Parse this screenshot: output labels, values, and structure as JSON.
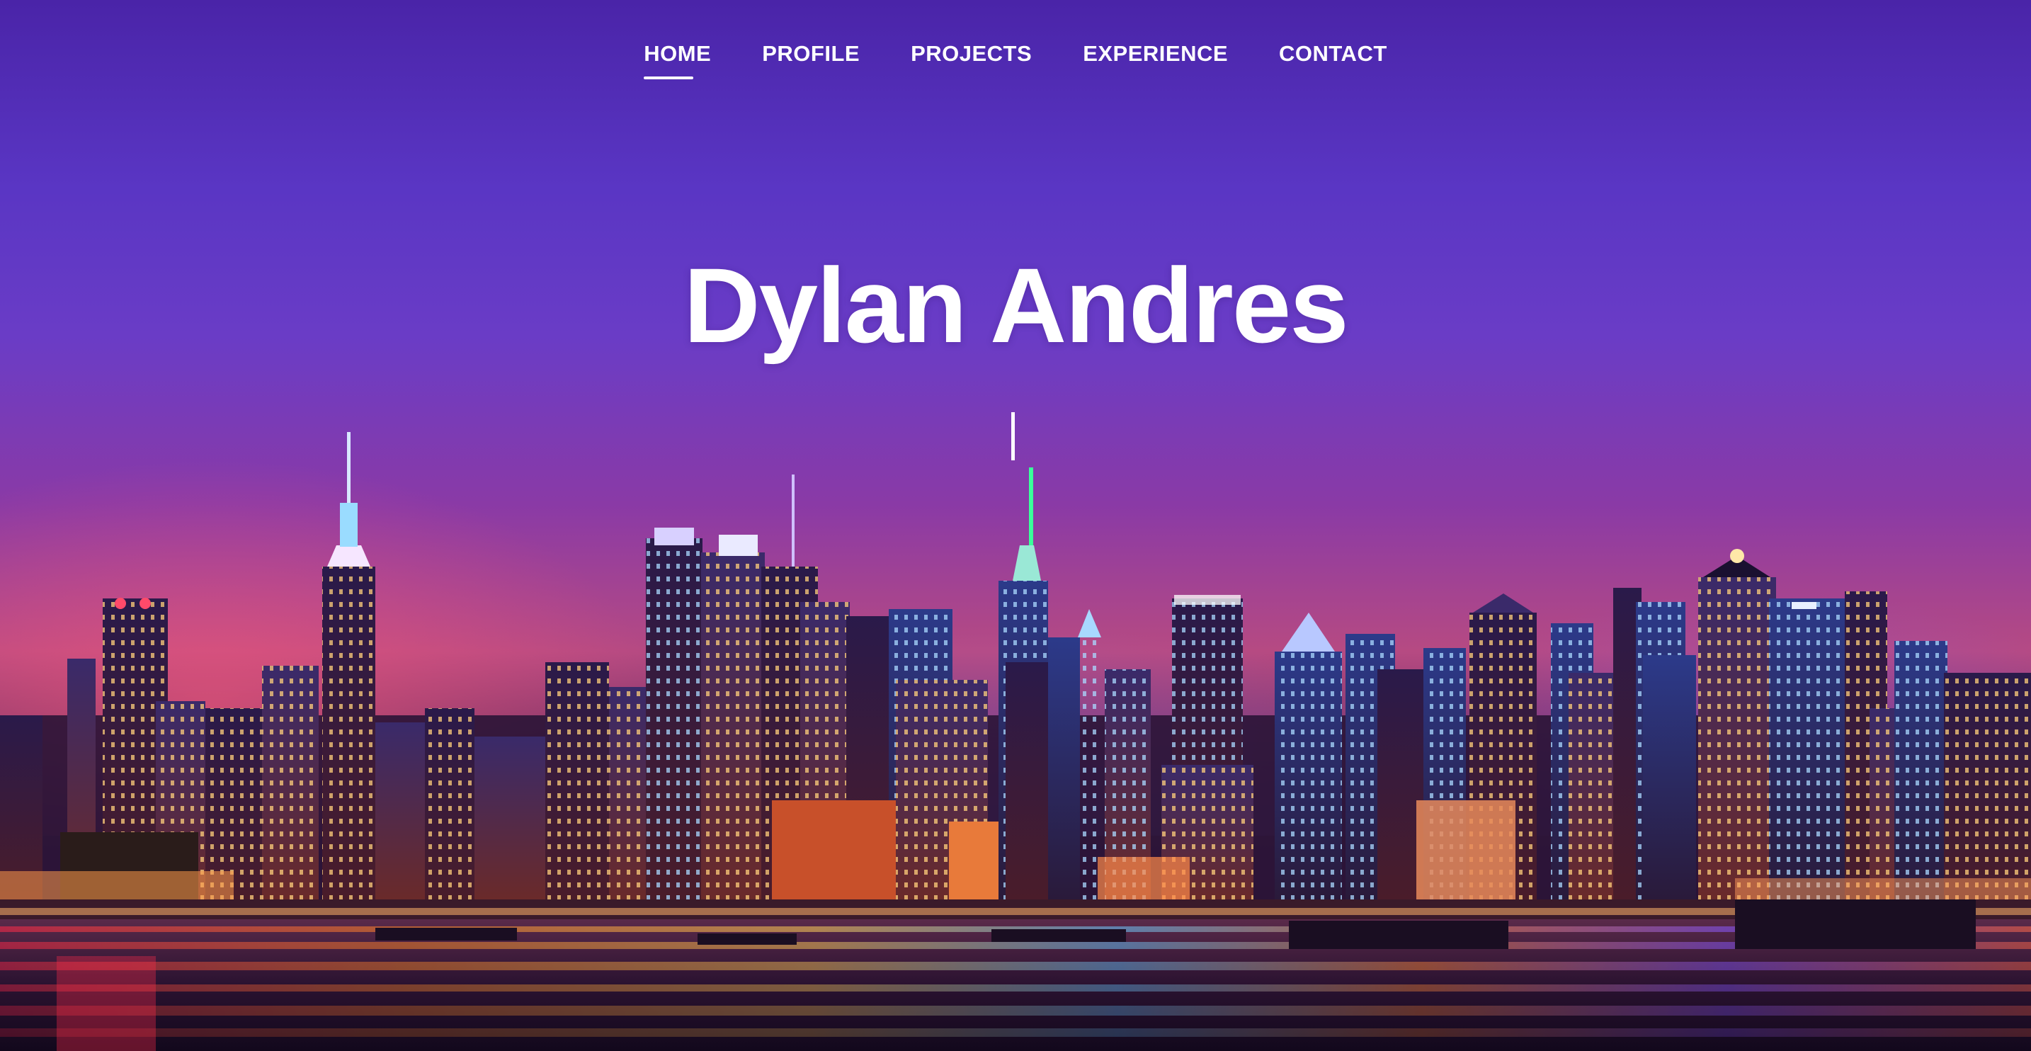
{
  "nav": {
    "items": [
      {
        "label": "HOME",
        "active": true
      },
      {
        "label": "PROFILE",
        "active": false
      },
      {
        "label": "PROJECTS",
        "active": false
      },
      {
        "label": "EXPERIENCE",
        "active": false
      },
      {
        "label": "CONTACT",
        "active": false
      }
    ]
  },
  "hero": {
    "title": "Dylan Andres"
  },
  "colors": {
    "text": "#ffffff",
    "sky_top": "#4a24a8",
    "sky_mid": "#8a3aa6",
    "horizon": "#b64a82"
  }
}
